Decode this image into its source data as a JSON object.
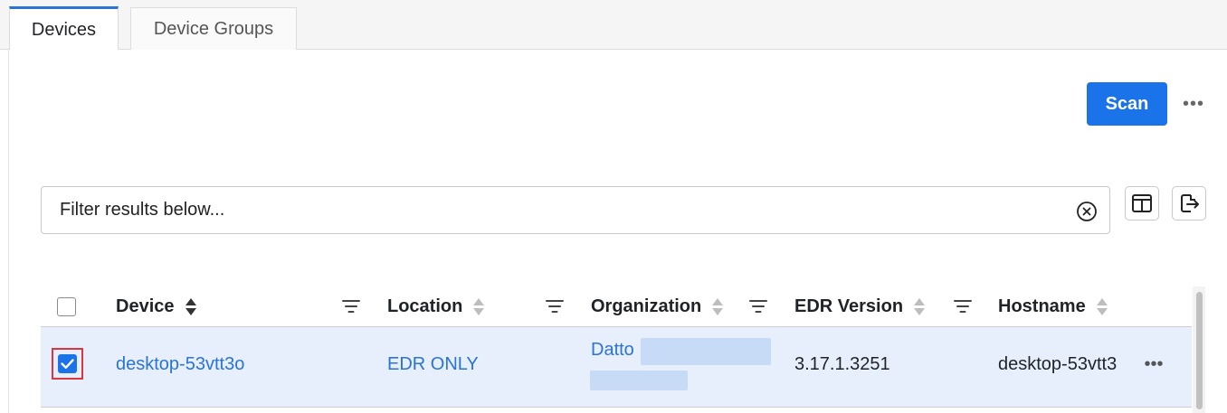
{
  "tabs": [
    {
      "label": "Devices",
      "active": true
    },
    {
      "label": "Device Groups",
      "active": false
    }
  ],
  "toolbar": {
    "scan_label": "Scan",
    "more_label": "•••"
  },
  "filter": {
    "placeholder": "Filter results below...",
    "value": ""
  },
  "table": {
    "columns": [
      {
        "label": "Device",
        "sort": "asc"
      },
      {
        "label": "Location",
        "sort": "none"
      },
      {
        "label": "Organization",
        "sort": "none"
      },
      {
        "label": "EDR Version",
        "sort": "none"
      },
      {
        "label": "Hostname",
        "sort": "none"
      }
    ],
    "rows": [
      {
        "selected": true,
        "device": "desktop-53vtt3o",
        "location": "EDR ONLY",
        "organization": "Datto",
        "edr_version": "3.17.1.3251",
        "hostname": "desktop-53vtt3",
        "more_label": "•••"
      }
    ]
  },
  "colors": {
    "accent": "#1a73e8",
    "link": "#2a73d8",
    "selected_row": "#e6effb",
    "highlight_border": "#d9363e"
  }
}
